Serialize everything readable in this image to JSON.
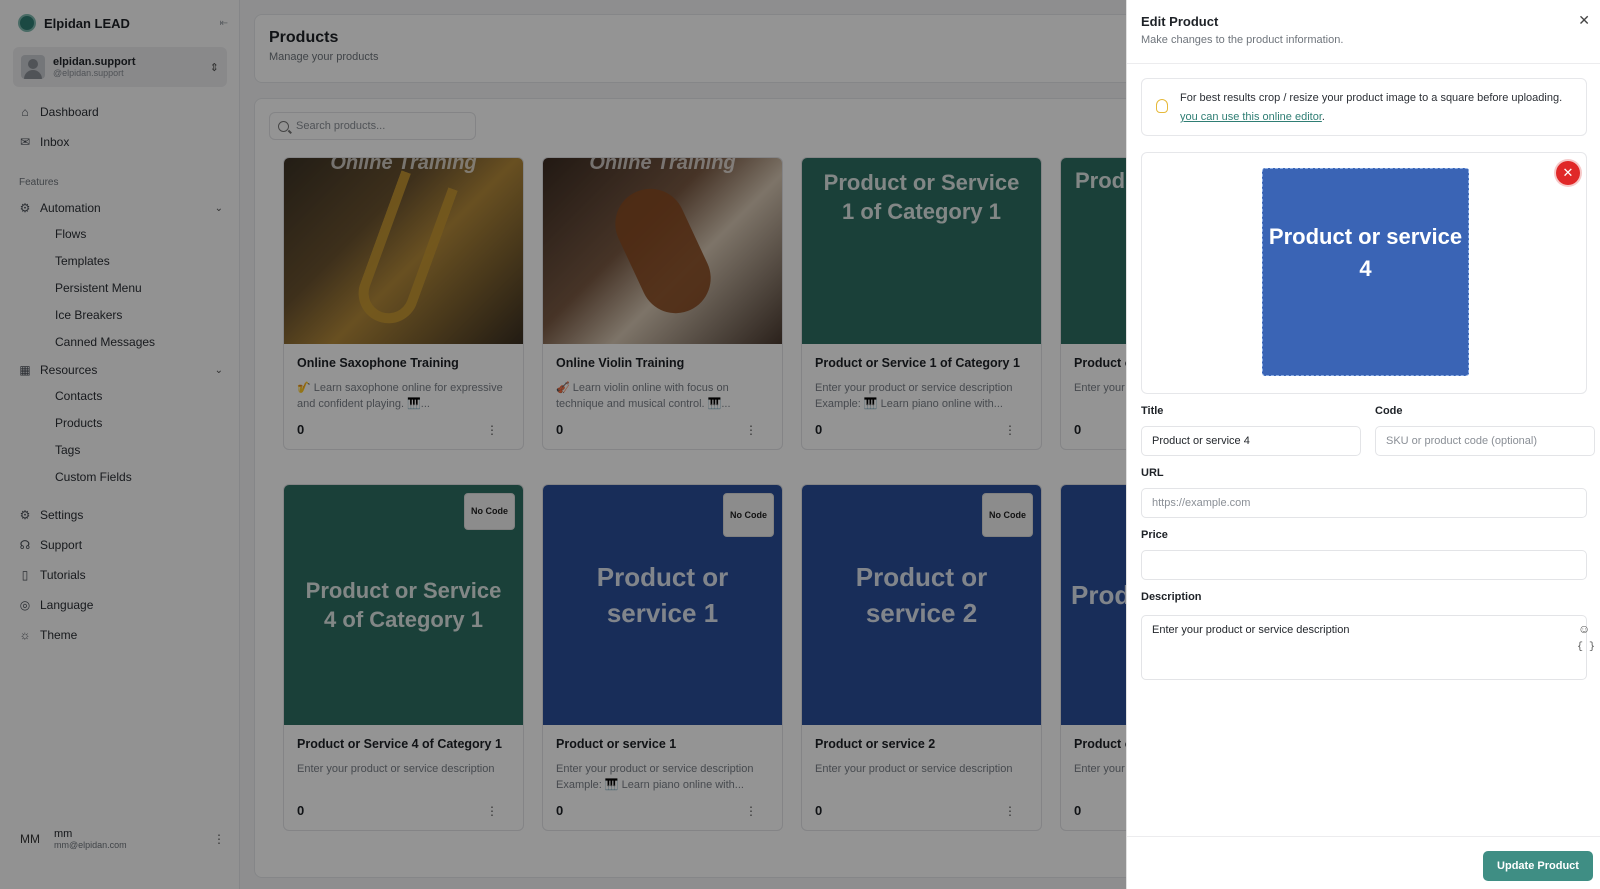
{
  "brand": {
    "name": "Elpidan LEAD"
  },
  "account": {
    "name": "elpidan.support",
    "handle": "@elpidan.support"
  },
  "nav": {
    "dashboard": "Dashboard",
    "inbox": "Inbox",
    "features_label": "Features",
    "automation": "Automation",
    "automation_items": [
      "Flows",
      "Templates",
      "Persistent Menu",
      "Ice Breakers",
      "Canned Messages"
    ],
    "resources": "Resources",
    "resources_items": [
      "Contacts",
      "Products",
      "Tags",
      "Custom Fields"
    ],
    "settings": "Settings",
    "support": "Support",
    "tutorials": "Tutorials",
    "language": "Language",
    "theme": "Theme"
  },
  "user": {
    "initials": "MM",
    "name": "mm",
    "email": "mm@elpidan.com"
  },
  "page": {
    "title": "Products",
    "subtitle": "Manage your products"
  },
  "search": {
    "placeholder": "Search products..."
  },
  "products": [
    {
      "image_text": "Online Training",
      "title": "Online Saxophone Training",
      "desc": "🎷 Learn saxophone online for expressive and confident playing. 🎹...",
      "price": "0"
    },
    {
      "image_text": "Online Training",
      "title": "Online Violin Training",
      "desc": "🎻 Learn violin online with focus on technique and musical control. 🎹...",
      "price": "0"
    },
    {
      "image_text": "Product or Service 1 of Category 1",
      "title": "Product or Service 1 of Category 1",
      "desc": "Enter your product or service description Example: 🎹 Learn piano online with...",
      "price": "0"
    },
    {
      "image_text": "Produ",
      "title": "Product o",
      "desc": "Enter your",
      "price": "0"
    },
    {
      "image_text": "Product or Service 4 of Category 1",
      "badge": "No Code",
      "title": "Product or Service 4 of Category 1",
      "desc": "Enter your product or service description",
      "price": "0"
    },
    {
      "image_text": "Product or service 1",
      "badge": "No Code",
      "title": "Product or service 1",
      "desc": "Enter your product or service description Example: 🎹 Learn piano online with...",
      "price": "0"
    },
    {
      "image_text": "Product or service 2",
      "badge": "No Code",
      "title": "Product or service 2",
      "desc": "Enter your product or service description",
      "price": "0"
    },
    {
      "image_text": "Prod",
      "title": "Product o",
      "desc": "Enter your",
      "price": "0"
    }
  ],
  "drawer": {
    "title": "Edit Product",
    "subtitle": "Make changes to the product information.",
    "tip_text": "For best results crop / resize your product image to a square before uploading.",
    "tip_link": "you can use this online editor",
    "tip_end": ".",
    "preview_text": "Product or service 4",
    "fields": {
      "title_label": "Title",
      "title_value": "Product or service 4",
      "code_label": "Code",
      "code_placeholder": "SKU or product code (optional)",
      "url_label": "URL",
      "url_placeholder": "https://example.com",
      "price_label": "Price",
      "price_value": "",
      "description_label": "Description",
      "description_placeholder": "Enter your product or service description"
    },
    "update_button": "Update Product"
  }
}
